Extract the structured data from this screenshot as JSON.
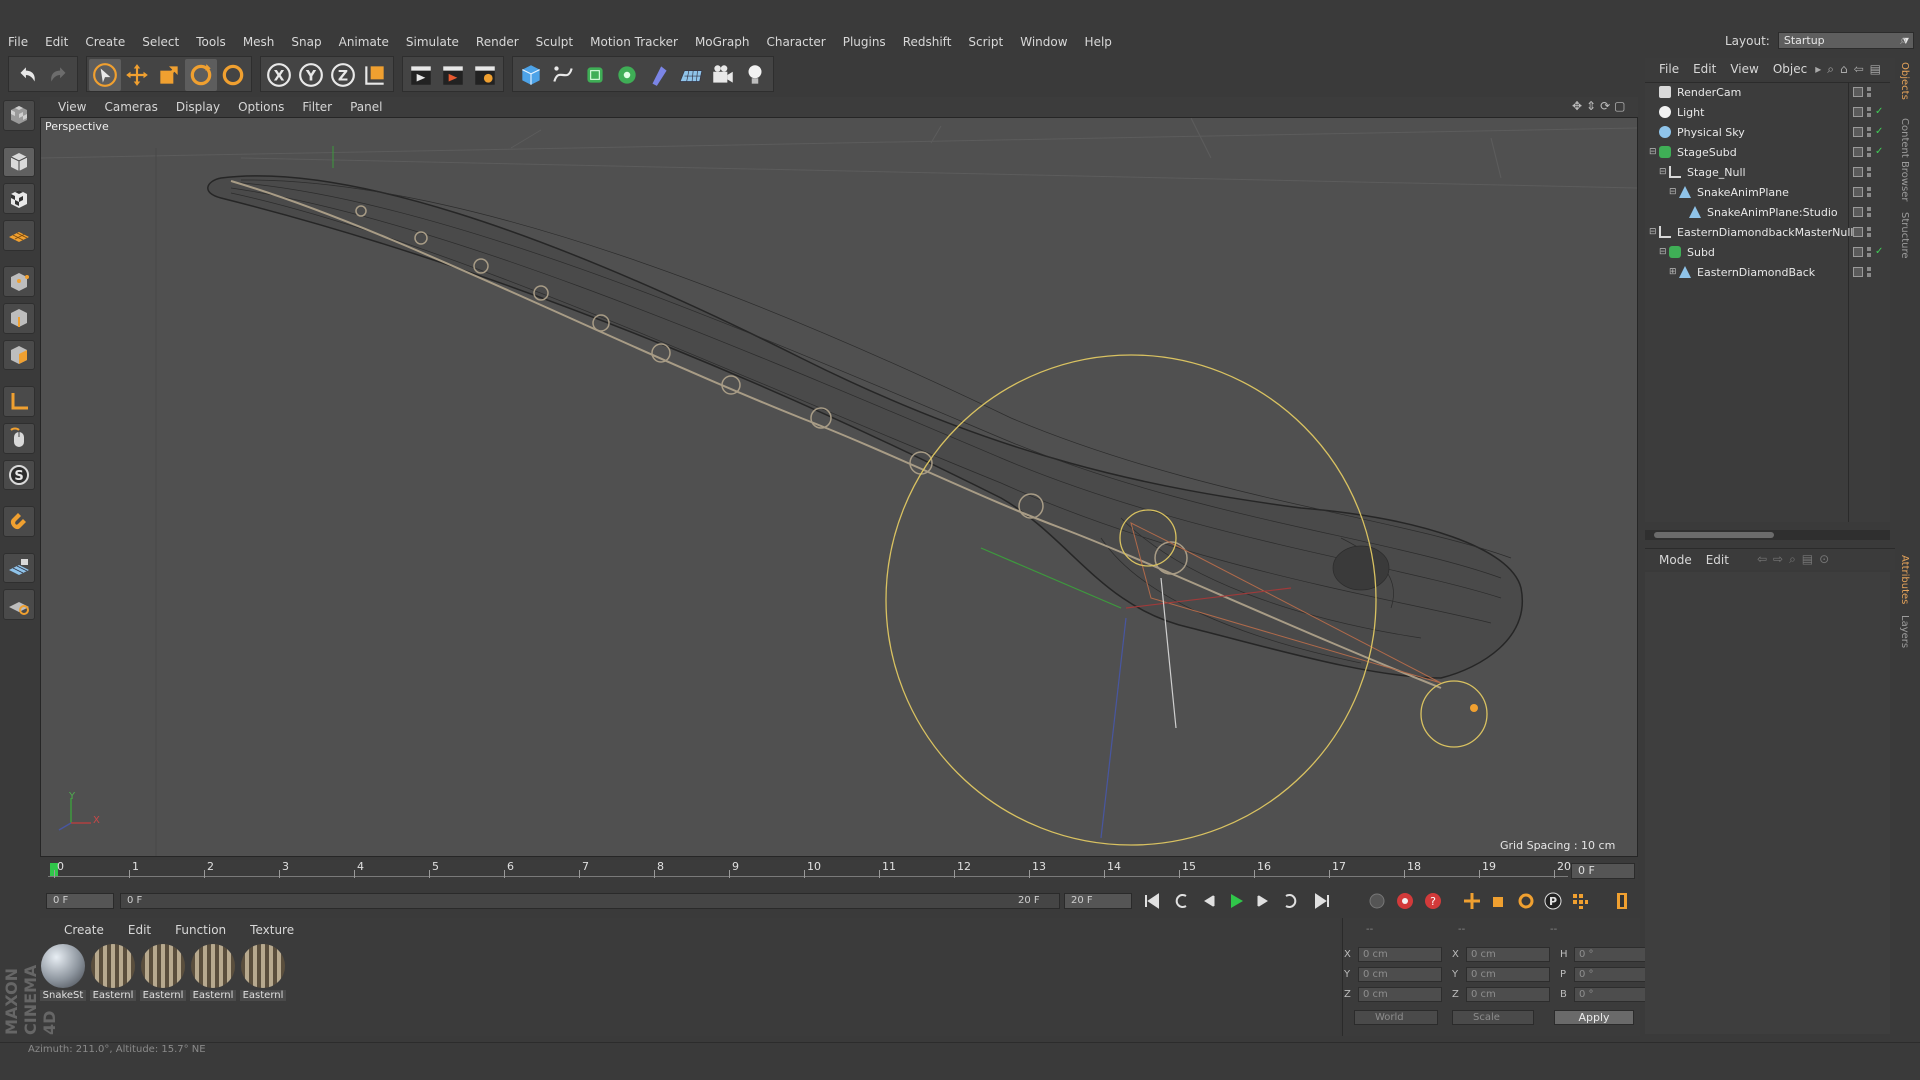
{
  "menu": [
    "File",
    "Edit",
    "Create",
    "Select",
    "Tools",
    "Mesh",
    "Snap",
    "Animate",
    "Simulate",
    "Render",
    "Sculpt",
    "Motion Tracker",
    "MoGraph",
    "Character",
    "Plugins",
    "Redshift",
    "Script",
    "Window",
    "Help"
  ],
  "layout": {
    "label": "Layout:",
    "value": "Startup"
  },
  "viewport": {
    "menu": [
      "View",
      "Cameras",
      "Display",
      "Options",
      "Filter",
      "Panel"
    ],
    "label": "Perspective",
    "grid_spacing": "Grid Spacing : 10 cm",
    "axis_y": "Y",
    "axis_x": "X"
  },
  "timeline": {
    "ticks": [
      "0",
      "1",
      "2",
      "3",
      "4",
      "5",
      "6",
      "7",
      "8",
      "9",
      "10",
      "11",
      "12",
      "13",
      "14",
      "15",
      "16",
      "17",
      "18",
      "19",
      "20"
    ],
    "current_frame": "0 F"
  },
  "transport": {
    "start_frame": "0 F",
    "range_start": "0 F",
    "range_end": "20 F",
    "end_frame": "20 F"
  },
  "materials": {
    "menu": [
      "Create",
      "Edit",
      "Function",
      "Texture"
    ],
    "items": [
      {
        "name": "SnakeSt",
        "color": "#9aa2ab"
      },
      {
        "name": "Easternl",
        "color": "#8c7d68"
      },
      {
        "name": "Easternl",
        "color": "#8c7d68"
      },
      {
        "name": "Easternl",
        "color": "#8c7d68"
      },
      {
        "name": "Easternl",
        "color": "#8c7d68"
      }
    ]
  },
  "coordinates": {
    "header": [
      "--",
      "--",
      "--"
    ],
    "rows": [
      {
        "a": "X",
        "av": "0 cm",
        "b": "X",
        "bv": "0 cm",
        "c": "H",
        "cv": "0 °"
      },
      {
        "a": "Y",
        "av": "0 cm",
        "b": "Y",
        "bv": "0 cm",
        "c": "P",
        "cv": "0 °"
      },
      {
        "a": "Z",
        "av": "0 cm",
        "b": "Z",
        "bv": "0 cm",
        "c": "B",
        "cv": "0 °"
      }
    ],
    "space": "World",
    "mode": "Scale",
    "apply": "Apply"
  },
  "object_manager": {
    "menu": [
      "File",
      "Edit",
      "View",
      "Objec"
    ],
    "objects": [
      {
        "name": "RenderCam",
        "indent": 0
      },
      {
        "name": "Light",
        "indent": 0
      },
      {
        "name": "Physical Sky",
        "indent": 0
      },
      {
        "name": "StageSubd",
        "indent": 0
      },
      {
        "name": "Stage_Null",
        "indent": 1
      },
      {
        "name": "SnakeAnimPlane",
        "indent": 2
      },
      {
        "name": "SnakeAnimPlane:Studio",
        "indent": 3
      },
      {
        "name": "EasternDiamondbackMasterNull",
        "indent": 0
      },
      {
        "name": "Subd",
        "indent": 1
      },
      {
        "name": "EasternDiamondBack",
        "indent": 2
      }
    ]
  },
  "attributes": {
    "menu": [
      "Mode",
      "Edit"
    ]
  },
  "side_tabs": [
    "Objects",
    "Content Browser",
    "Structure",
    "Attributes",
    "Layers"
  ],
  "logo": "MAXON CINEMA 4D",
  "status": "Azimuth: 211.0°, Altitude: 15.7° NE",
  "colors": {
    "accent": "#f0a030",
    "selection": "#e6c34a",
    "bg": "#505050"
  }
}
